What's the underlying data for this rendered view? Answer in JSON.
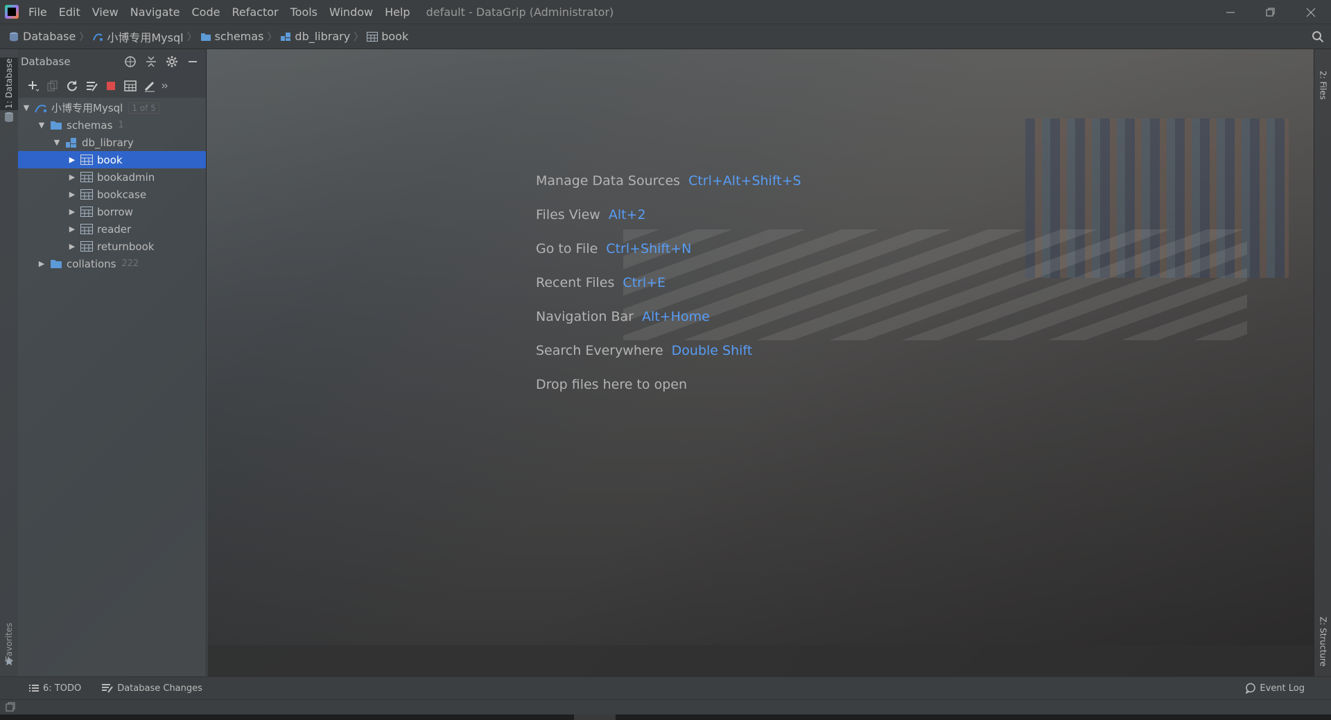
{
  "app": {
    "window_title": "default - DataGrip (Administrator)",
    "menu": [
      "File",
      "Edit",
      "View",
      "Navigate",
      "Code",
      "Refactor",
      "Tools",
      "Window",
      "Help"
    ],
    "window_controls": [
      "minimize",
      "restore",
      "close"
    ]
  },
  "breadcrumb": [
    {
      "label": "Database",
      "icon": "database-icon"
    },
    {
      "label": "小博专用Mysql",
      "icon": "mysql-datasource-icon"
    },
    {
      "label": "schemas",
      "icon": "folder-icon"
    },
    {
      "label": "db_library",
      "icon": "schema-icon"
    },
    {
      "label": "book",
      "icon": "table-icon"
    }
  ],
  "left_stripe": {
    "database_tab": "1: Database",
    "favorites_tab": "Favorites"
  },
  "right_stripe": {
    "files_tab": "2: Files",
    "structure_tab": "Z: Structure"
  },
  "database_panel": {
    "title": "Database",
    "tree": {
      "datasource": {
        "label": "小博专用Mysql",
        "count": "1 of 5"
      },
      "schemas": {
        "label": "schemas",
        "count": "1"
      },
      "schema": {
        "label": "db_library"
      },
      "tables": [
        "book",
        "bookadmin",
        "bookcase",
        "borrow",
        "reader",
        "returnbook"
      ],
      "selected_table": "book",
      "collations": {
        "label": "collations",
        "count": "222"
      }
    }
  },
  "welcome": {
    "hints": [
      {
        "label": "Manage Data Sources",
        "key": "Ctrl+Alt+Shift+S"
      },
      {
        "label": "Files View",
        "key": "Alt+2"
      },
      {
        "label": "Go to File",
        "key": "Ctrl+Shift+N"
      },
      {
        "label": "Recent Files",
        "key": "Ctrl+E"
      },
      {
        "label": "Navigation Bar",
        "key": "Alt+Home"
      },
      {
        "label": "Search Everywhere",
        "key": "Double Shift"
      },
      {
        "label": "Drop files here to open",
        "key": ""
      }
    ]
  },
  "bottom_tabs": {
    "todo": "6: TODO",
    "db_changes": "Database Changes",
    "event_log": "Event Log"
  },
  "colors": {
    "accent_blue": "#589df6",
    "selection": "#2f65ca",
    "stop_red": "#db4b4b"
  }
}
